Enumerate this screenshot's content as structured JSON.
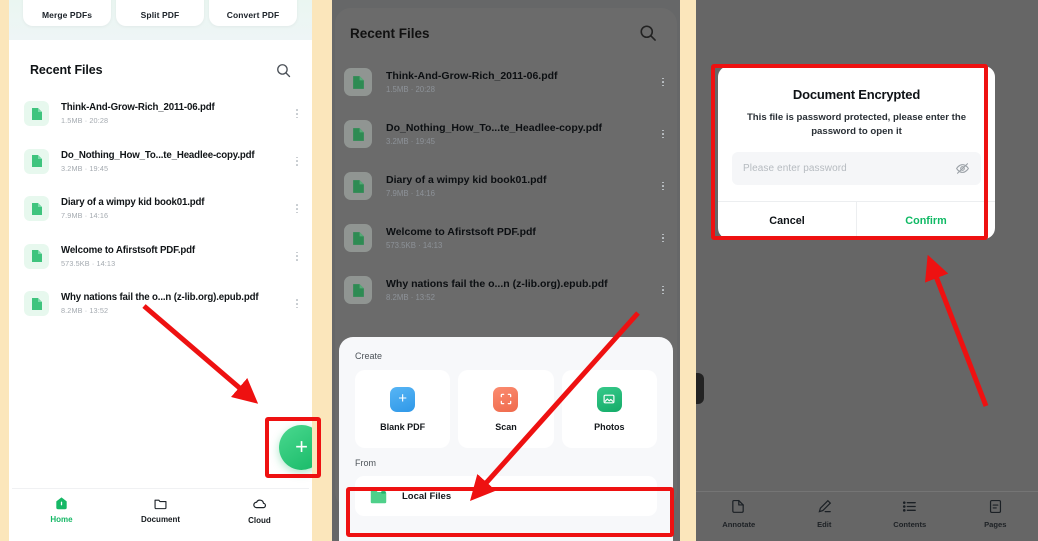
{
  "panel1": {
    "tools": [
      {
        "label": "Merge PDFs"
      },
      {
        "label": "Split PDF"
      },
      {
        "label": "Convert PDF"
      }
    ],
    "recent_files_title": "Recent Files",
    "search_icon": "search-icon",
    "files": [
      {
        "name": "Think-And-Grow-Rich_2011-06.pdf",
        "meta": "1.5MB · 20:28"
      },
      {
        "name": "Do_Nothing_How_To...te_Headlee-copy.pdf",
        "meta": "3.2MB · 19:45"
      },
      {
        "name": "Diary of a wimpy kid book01.pdf",
        "meta": "7.9MB · 14:16"
      },
      {
        "name": "Welcome to Afirstsoft PDF.pdf",
        "meta": "573.5KB · 14:13"
      },
      {
        "name": "Why nations fail the o...n (z-lib.org).epub.pdf",
        "meta": "8.2MB · 13:52"
      }
    ],
    "fab": {
      "label": "+",
      "icon": "plus-icon",
      "color": "#16b866"
    },
    "tabs": [
      {
        "label": "Home",
        "icon": "home-icon",
        "active": true
      },
      {
        "label": "Document",
        "icon": "folder-icon",
        "active": false
      },
      {
        "label": "Cloud",
        "icon": "cloud-icon",
        "active": false
      }
    ]
  },
  "panel2": {
    "recent_files_title": "Recent Files",
    "search_icon": "search-icon",
    "files": [
      {
        "name": "Think-And-Grow-Rich_2011-06.pdf",
        "meta": "1.5MB · 20:28"
      },
      {
        "name": "Do_Nothing_How_To...te_Headlee-copy.pdf",
        "meta": "3.2MB · 19:45"
      },
      {
        "name": "Diary of a wimpy kid book01.pdf",
        "meta": "7.9MB · 14:16"
      },
      {
        "name": "Welcome to Afirstsoft PDF.pdf",
        "meta": "573.5KB · 14:13"
      },
      {
        "name": "Why nations fail the o...n (z-lib.org).epub.pdf",
        "meta": "8.2MB · 13:52"
      }
    ],
    "sheet": {
      "create_label": "Create",
      "create_items": [
        {
          "label": "Blank PDF",
          "icon": "blank-pdf-icon",
          "color": "#3aa4f0"
        },
        {
          "label": "Scan",
          "icon": "scan-icon",
          "color": "#f4775c"
        },
        {
          "label": "Photos",
          "icon": "photos-icon",
          "color": "#1fba74"
        }
      ],
      "from_label": "From",
      "local_files_label": "Local Files",
      "local_files_icon": "folder-icon"
    }
  },
  "panel3": {
    "dialog": {
      "title": "Document Encrypted",
      "description": "This file is password protected, please enter the password to open it",
      "password_value": "",
      "password_placeholder": "Please enter password",
      "eye_icon": "eye-off-icon",
      "cancel_label": "Cancel",
      "confirm_label": "Confirm",
      "confirm_color": "#0fb964"
    },
    "tabs": [
      {
        "label": "Annotate",
        "icon": "annotate-icon"
      },
      {
        "label": "Edit",
        "icon": "pencil-icon"
      },
      {
        "label": "Contents",
        "icon": "list-icon"
      },
      {
        "label": "Pages",
        "icon": "pages-icon"
      }
    ]
  },
  "annotations": {
    "color": "#ee1111",
    "arrows": [
      {
        "name": "arrow-to-fab"
      },
      {
        "name": "arrow-to-local-files"
      },
      {
        "name": "arrow-to-password-dialog"
      }
    ],
    "boxes": [
      {
        "name": "highlight-fab"
      },
      {
        "name": "highlight-local-files"
      },
      {
        "name": "highlight-password-dialog"
      }
    ]
  }
}
